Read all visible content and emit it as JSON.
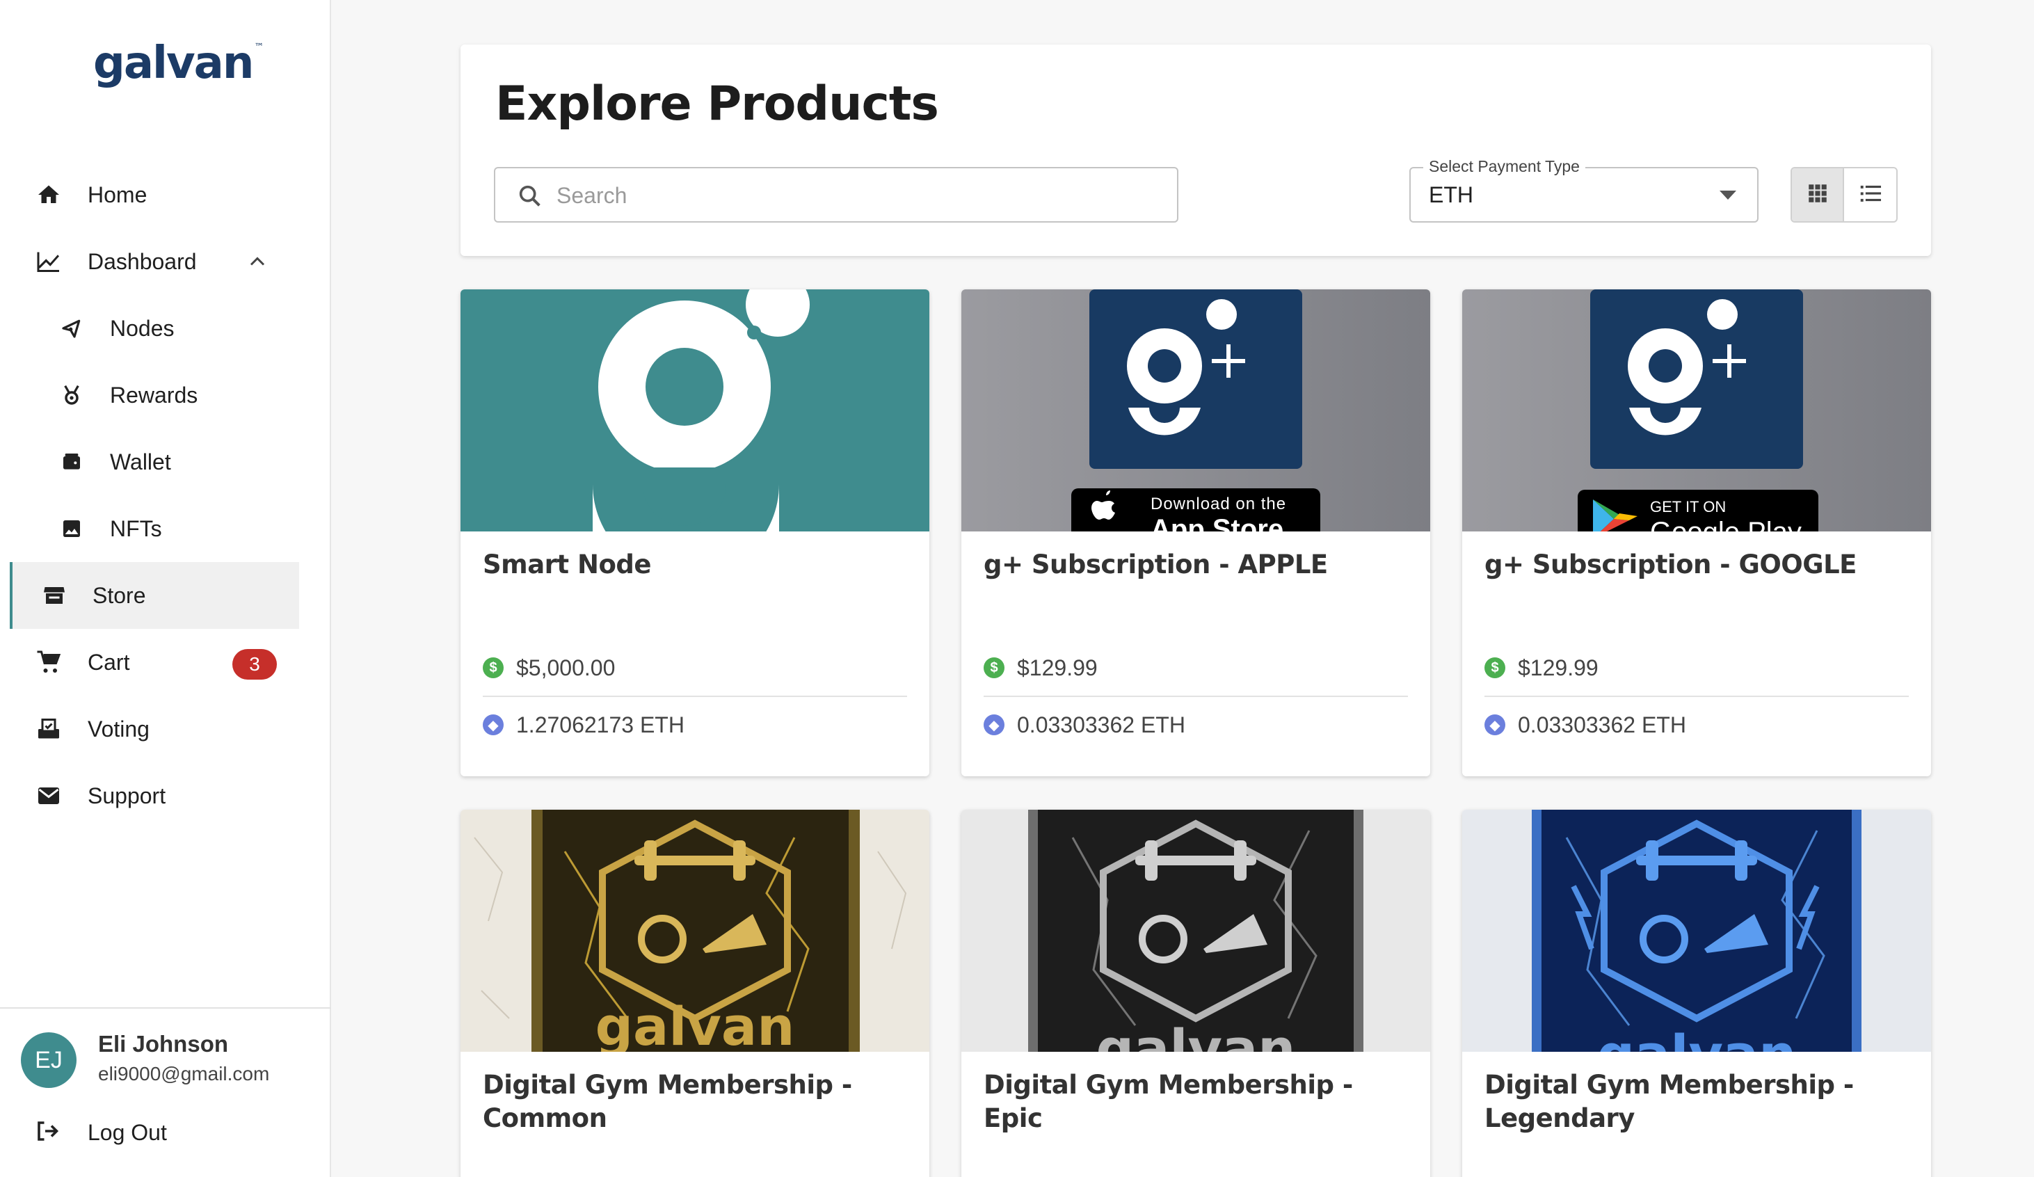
{
  "brand": {
    "logo_text": "galvan",
    "trademark": "™"
  },
  "sidebar": {
    "items": [
      {
        "label": "Home",
        "icon": "home-icon"
      },
      {
        "label": "Dashboard",
        "icon": "chart-line-icon"
      },
      {
        "label": "Nodes",
        "icon": "node-share-icon"
      },
      {
        "label": "Rewards",
        "icon": "medal-icon"
      },
      {
        "label": "Wallet",
        "icon": "wallet-icon"
      },
      {
        "label": "NFTs",
        "icon": "image-icon"
      },
      {
        "label": "Store",
        "icon": "store-icon"
      },
      {
        "label": "Cart",
        "icon": "cart-icon",
        "badge": "3"
      },
      {
        "label": "Voting",
        "icon": "ballot-icon"
      },
      {
        "label": "Support",
        "icon": "mail-icon"
      }
    ],
    "active": "Store"
  },
  "user": {
    "initials": "EJ",
    "name": "Eli Johnson",
    "email": "eli9000@gmail.com",
    "logout_label": "Log Out"
  },
  "header": {
    "title": "Explore Products",
    "search": {
      "placeholder": "Search",
      "value": ""
    },
    "payment": {
      "label": "Select Payment Type",
      "value": "ETH"
    },
    "view_mode": "grid"
  },
  "products": [
    {
      "name": "Smart Node",
      "usd": "$5,000.00",
      "eth": "1.27062173 ETH",
      "art": "teal-g-logo"
    },
    {
      "name": "g+ Subscription - APPLE",
      "usd": "$129.99",
      "eth": "0.03303362 ETH",
      "art": "app-store",
      "store_line1": "Download on the",
      "store_line2": "App Store"
    },
    {
      "name": "g+ Subscription - GOOGLE",
      "usd": "$129.99",
      "eth": "0.03303362 ETH",
      "art": "google-play",
      "store_line1": "GET IT ON",
      "store_line2": "Google Play"
    },
    {
      "name": "Digital Gym Membership - Common",
      "art": "gym-gold"
    },
    {
      "name": "Digital Gym Membership - Epic",
      "art": "gym-silver"
    },
    {
      "name": "Digital Gym Membership - Legendary",
      "art": "gym-blue"
    }
  ],
  "card_art_text": {
    "gym_logo": "galvan"
  },
  "colors": {
    "accent": "#3f8c8e",
    "navy": "#1c3b66",
    "badge": "#c62f2a",
    "usd": "#4caf50",
    "eth": "#6b7fdd"
  }
}
